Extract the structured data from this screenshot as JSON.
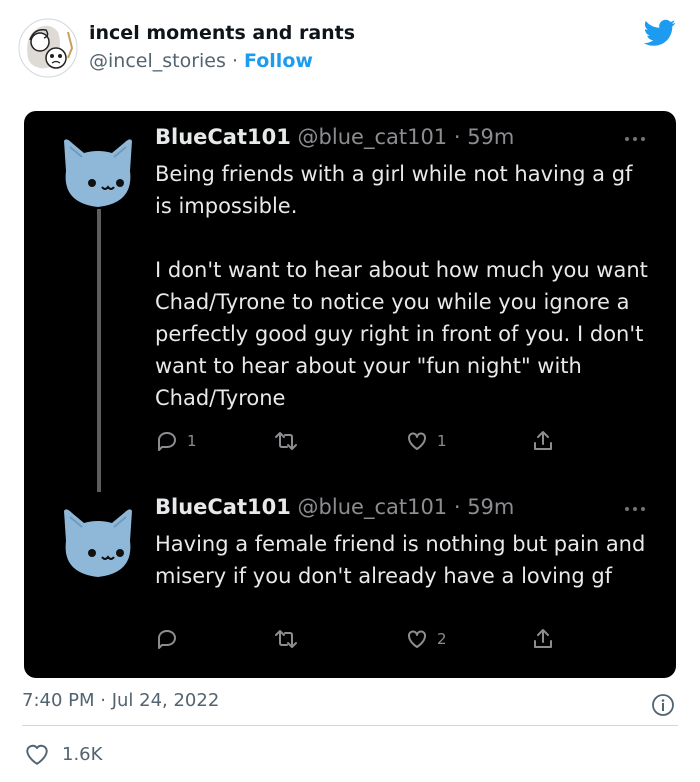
{
  "author": {
    "name": "incel moments and rants",
    "handle": "@incel_stories",
    "separator": "·",
    "follow_label": "Follow"
  },
  "tweets": [
    {
      "name": "BlueCat101",
      "handle": "@blue_cat101 · 59m",
      "text": "Being friends with a girl while not having a gf is impossible.\n\nI don't want to hear about how much you want Chad/Tyrone to notice you while you ignore a perfectly good guy right in front of you. I don't want to hear about your \"fun night\" with Chad/Tyrone",
      "reply_count": "1",
      "retweet_count": "",
      "like_count": "1"
    },
    {
      "name": "BlueCat101",
      "handle": "@blue_cat101 · 59m",
      "text": "Having a female friend is nothing but pain and misery if you don't already have a loving gf",
      "reply_count": "",
      "retweet_count": "",
      "like_count": "2"
    }
  ],
  "footer": {
    "timestamp": "7:40 PM · Jul 24, 2022",
    "likes": "1.6K"
  },
  "colors": {
    "twitter_blue": "#1d9bf0",
    "screenshot_bg": "#000000",
    "cat_blue": "#8fb8d8"
  },
  "icons": [
    "author-avatar",
    "twitter-bird-icon",
    "cat-avatar",
    "more-icon",
    "reply-icon",
    "retweet-icon",
    "like-icon",
    "share-icon",
    "info-icon",
    "heart-icon"
  ]
}
